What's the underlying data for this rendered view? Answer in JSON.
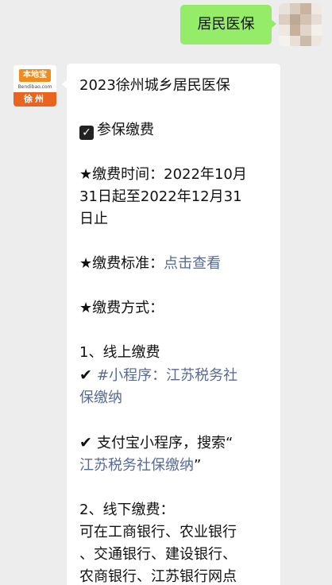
{
  "outgoing": {
    "text": "居民医保"
  },
  "incoming": {
    "avatar": {
      "brand": "本地宝",
      "url": "Bendibao.com",
      "city": "徐州"
    },
    "title": "2023徐州城乡居民医保",
    "section_label": "参保缴费",
    "time_line1": "★缴费时间：2022年10月",
    "time_line2": "31日起至2022年12月31",
    "time_line3": "日止",
    "standard_label": "★缴费标准：",
    "standard_link": "点击查看",
    "method_label": "★缴费方式：",
    "online_label": "1、线上缴费",
    "online_item1_line1": "#小程序：江苏税务社",
    "online_item1_line2": "保缴纳",
    "online_item2_prefix": "支付宝小程序，搜索“",
    "online_item2_link": "江苏税务社保缴纳",
    "online_item2_suffix": "”",
    "offline_label": "2、线下缴费：",
    "offline_line1": "可在工商银行、农业银行",
    "offline_line2": "、交通银行、建设银行、",
    "offline_line3": "农商银行、江苏银行网点"
  },
  "colors": {
    "background": "#ededed",
    "outgoing_bubble": "#95ec69",
    "incoming_bubble": "#ffffff",
    "link": "#576b95",
    "logo_orange": "#e8641f"
  },
  "icons": [
    "check-box-icon",
    "check-mark-icon"
  ]
}
